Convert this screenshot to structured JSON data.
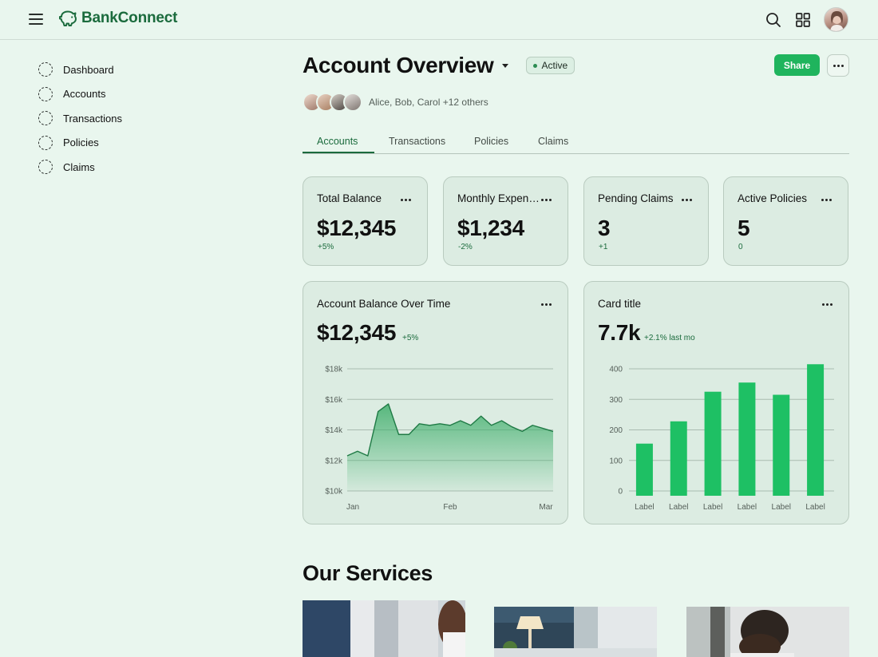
{
  "app": {
    "name": "BankConnect"
  },
  "colors": {
    "accent": "#1fb45d",
    "brand": "#1b6b3d",
    "background": "#e9f6ee",
    "card": "#dcece2"
  },
  "header": {
    "icons": [
      "menu-icon",
      "search-icon",
      "grid-icon",
      "avatar"
    ]
  },
  "sidebar": {
    "items": [
      {
        "label": "Dashboard",
        "icon": "dashed-circle-icon"
      },
      {
        "label": "Accounts",
        "icon": "dashed-circle-icon"
      },
      {
        "label": "Transactions",
        "icon": "dashed-circle-icon"
      },
      {
        "label": "Policies",
        "icon": "dashed-circle-icon"
      },
      {
        "label": "Claims",
        "icon": "dashed-circle-icon"
      }
    ]
  },
  "page": {
    "title": "Account Overview",
    "status": "Active",
    "share_label": "Share",
    "collaborators_text": "Alice, Bob, Carol +12 others"
  },
  "tabs": [
    {
      "label": "Accounts",
      "active": true
    },
    {
      "label": "Transactions",
      "active": false
    },
    {
      "label": "Policies",
      "active": false
    },
    {
      "label": "Claims",
      "active": false
    }
  ],
  "kpis": [
    {
      "title": "Total Balance",
      "value": "$12,345",
      "change": "+5%"
    },
    {
      "title": "Monthly Expenses",
      "value": "$1,234",
      "change": "-2%"
    },
    {
      "title": "Pending Claims",
      "value": "3",
      "change": "+1"
    },
    {
      "title": "Active Policies",
      "value": "5",
      "change": "0"
    }
  ],
  "balance_card": {
    "title": "Account Balance Over Time",
    "value": "$12,345",
    "change": "+5%"
  },
  "bar_card": {
    "title": "Card title",
    "value": "7.7k",
    "change": "+2.1% last mo"
  },
  "chart_data": [
    {
      "type": "area",
      "title": "Account Balance Over Time",
      "x_tick_labels": [
        "Jan",
        "Feb",
        "Mar"
      ],
      "y_tick_labels": [
        "$10k",
        "$12k",
        "$14k",
        "$16k",
        "$18k"
      ],
      "ylim": [
        10000,
        18000
      ],
      "grid": true,
      "values": [
        12300,
        12600,
        12300,
        15200,
        15700,
        13700,
        13700,
        14400,
        14300,
        14400,
        14300,
        14600,
        14300,
        14900,
        14300,
        14600,
        14200,
        13900,
        14300,
        14100,
        13900
      ],
      "color": "#2aa15a"
    },
    {
      "type": "bar",
      "title": "Card title",
      "categories": [
        "Label",
        "Label",
        "Label",
        "Label",
        "Label",
        "Label"
      ],
      "values": [
        155,
        228,
        325,
        355,
        315,
        415
      ],
      "y_tick_labels": [
        "0",
        "100",
        "200",
        "300",
        "400"
      ],
      "ylim": [
        0,
        400
      ],
      "grid": true,
      "color": "#1ec064"
    }
  ],
  "services": {
    "title": "Our Services"
  }
}
